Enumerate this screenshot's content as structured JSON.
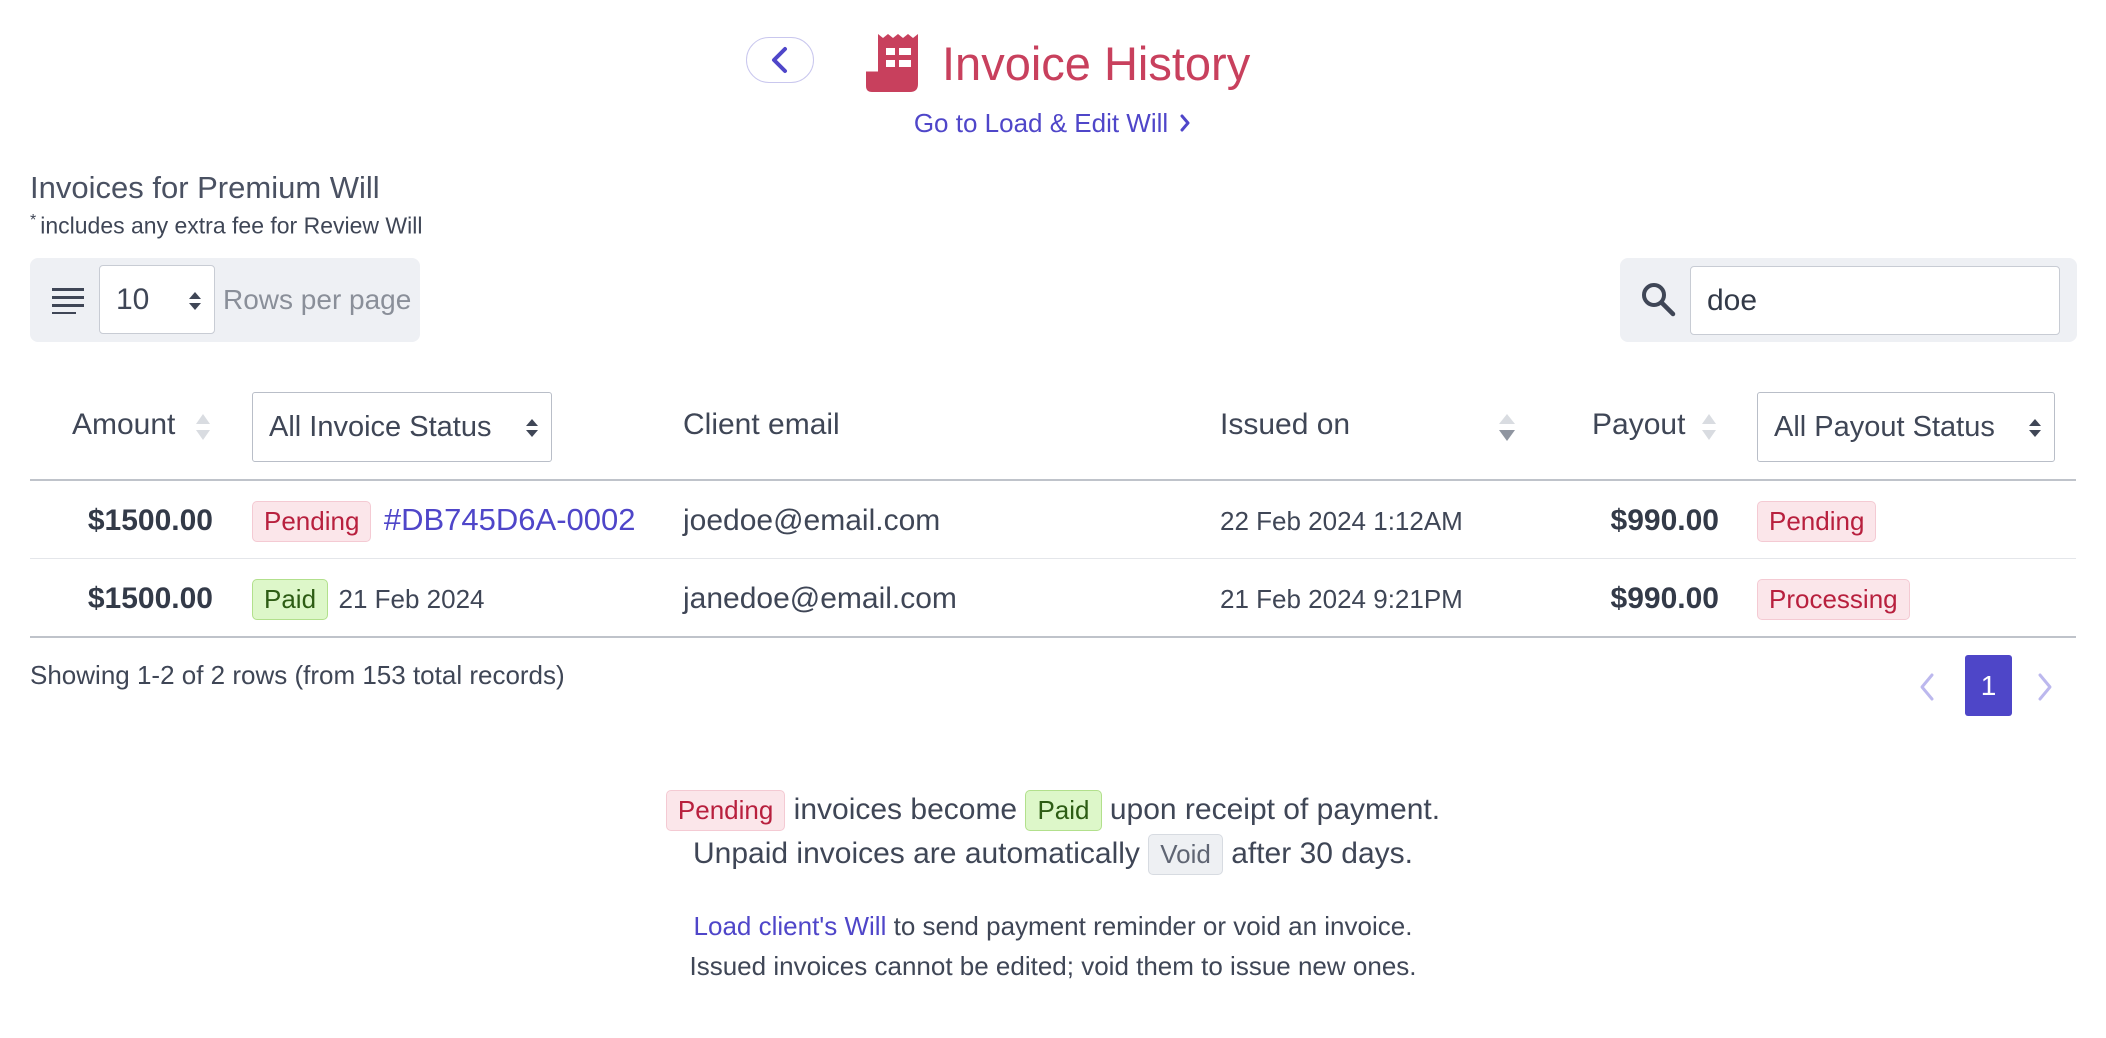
{
  "header": {
    "title": "Invoice History",
    "goto_link": "Go to Load & Edit Will",
    "brand_color": "#c8405d",
    "link_color": "#4f46c9"
  },
  "section": {
    "title": "Invoices for Premium Will",
    "footnote_mark": "*",
    "footnote": "includes any extra fee for Review Will"
  },
  "controls": {
    "rows_per_page_value": "10",
    "rows_per_page_label": "Rows per page",
    "search_value": "doe"
  },
  "table": {
    "columns": {
      "amount": "Amount",
      "invoice_status_filter": "All Invoice Status",
      "client_email": "Client email",
      "issued_on": "Issued on",
      "payout": "Payout",
      "payout_status_filter": "All Payout Status"
    },
    "rows": [
      {
        "amount": "$1500.00",
        "status": "Pending",
        "invoice_ref": "#DB745D6A-0002",
        "email": "joedoe@email.com",
        "issued": "22 Feb 2024 1:12AM",
        "payout": "$990.00",
        "payout_status": "Pending"
      },
      {
        "amount": "$1500.00",
        "status": "Paid",
        "paid_date": "21 Feb 2024",
        "email": "janedoe@email.com",
        "issued": "21 Feb 2024 9:21PM",
        "payout": "$990.00",
        "payout_status": "Processing"
      }
    ]
  },
  "pagination": {
    "summary": "Showing 1-2 of 2 rows (from 153 total records)",
    "current_page": "1"
  },
  "info": {
    "badge_pending": "Pending",
    "text_become": "invoices become",
    "badge_paid": "Paid",
    "text_receipt": "upon receipt of payment.",
    "text_unpaid": "Unpaid invoices are automatically",
    "badge_void": "Void",
    "text_after": "after 30 days.",
    "load_link": "Load client's Will",
    "text_reminder": "to send payment reminder or void an invoice.",
    "text_issued": "Issued invoices cannot be edited; void them to issue new ones."
  }
}
